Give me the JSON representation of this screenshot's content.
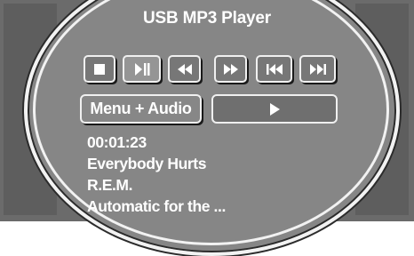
{
  "header": {
    "title": "USB MP3 Player"
  },
  "controls": [
    {
      "name": "stop-button",
      "icon": "stop-icon"
    },
    {
      "name": "play-pause-button",
      "icon": "play-pause-icon"
    },
    {
      "name": "rewind-button",
      "icon": "rewind-icon"
    },
    {
      "name": "fast-forward-button",
      "icon": "fast-forward-icon"
    },
    {
      "name": "previous-track-button",
      "icon": "skip-back-icon"
    },
    {
      "name": "next-track-button",
      "icon": "skip-forward-icon"
    }
  ],
  "menu": {
    "label": "Menu + Audio"
  },
  "status_icon": "play-icon",
  "track": {
    "time": "00:01:23",
    "title": "Everybody Hurts",
    "artist": "R.E.M.",
    "album": "Automatic for the ..."
  },
  "colors": {
    "frame": "#f2f2f2",
    "oval": "#868686",
    "background": "#6b6b6b",
    "text": "#ffffff"
  }
}
